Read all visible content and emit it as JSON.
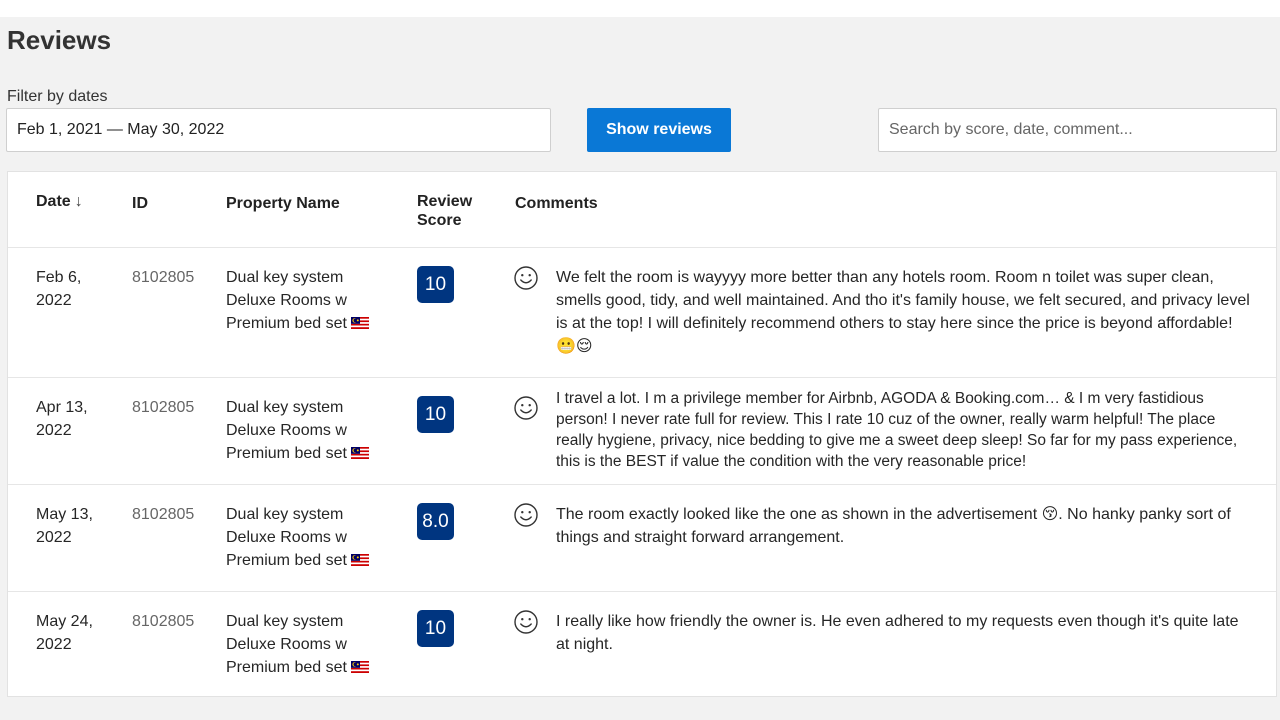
{
  "page": {
    "title": "Reviews"
  },
  "filter": {
    "label": "Filter by dates",
    "date_range": "Feb 1, 2021 — May 30, 2022",
    "show_button": "Show reviews",
    "search_placeholder": "Search by score, date, comment..."
  },
  "table": {
    "headers": {
      "date": "Date",
      "date_sort_icon": "↓",
      "id": "ID",
      "property_name": "Property Name",
      "review_score_line1": "Review",
      "review_score_line2": "Score",
      "comments": "Comments"
    },
    "rows": [
      {
        "date_line1": "Feb 6,",
        "date_line2": "2022",
        "id": "8102805",
        "property_line1": "Dual key system",
        "property_line2": "Deluxe Rooms w",
        "property_line3": "Premium bed set",
        "score": "10",
        "comment": "We felt the room is wayyyy more better than any hotels room. Room n toilet was super clean, smells good, tidy, and well maintained. And tho it's family house, we felt secured, and privacy level is at the top! I will definitely recommend others to stay here since the price is beyond affordable! 😬😌"
      },
      {
        "date_line1": "Apr 13,",
        "date_line2": "2022",
        "id": "8102805",
        "property_line1": "Dual key system",
        "property_line2": "Deluxe Rooms w",
        "property_line3": "Premium bed set",
        "score": "10",
        "comment": "I travel a lot. I m a privilege member for Airbnb, AGODA & Booking.com… & I m very fastidious person! I never rate full for review. This I rate 10 cuz of the owner, really warm helpful! The place really hygiene, privacy, nice bedding to give me a sweet deep sleep! So far for my pass experience, this is the BEST if value the condition with the very reasonable price!"
      },
      {
        "date_line1": "May 13,",
        "date_line2": "2022",
        "id": "8102805",
        "property_line1": "Dual key system",
        "property_line2": "Deluxe Rooms w",
        "property_line3": "Premium bed set",
        "score": "8.0",
        "comment": "The room exactly looked like the one as shown in the advertisement 😚. No hanky panky sort of things and straight forward arrangement."
      },
      {
        "date_line1": "May 24,",
        "date_line2": "2022",
        "id": "8102805",
        "property_line1": "Dual key system",
        "property_line2": "Deluxe Rooms w",
        "property_line3": "Premium bed set",
        "score": "10",
        "comment": "I really like how friendly the owner is. He even adhered to my requests even though it's quite late at night."
      }
    ]
  },
  "icons": {
    "sentiment": "smiley-icon",
    "flag": "malaysia-flag-icon"
  },
  "colors": {
    "primary_button": "#0a78d6",
    "score_badge": "#003580",
    "background": "#f2f2f2"
  }
}
